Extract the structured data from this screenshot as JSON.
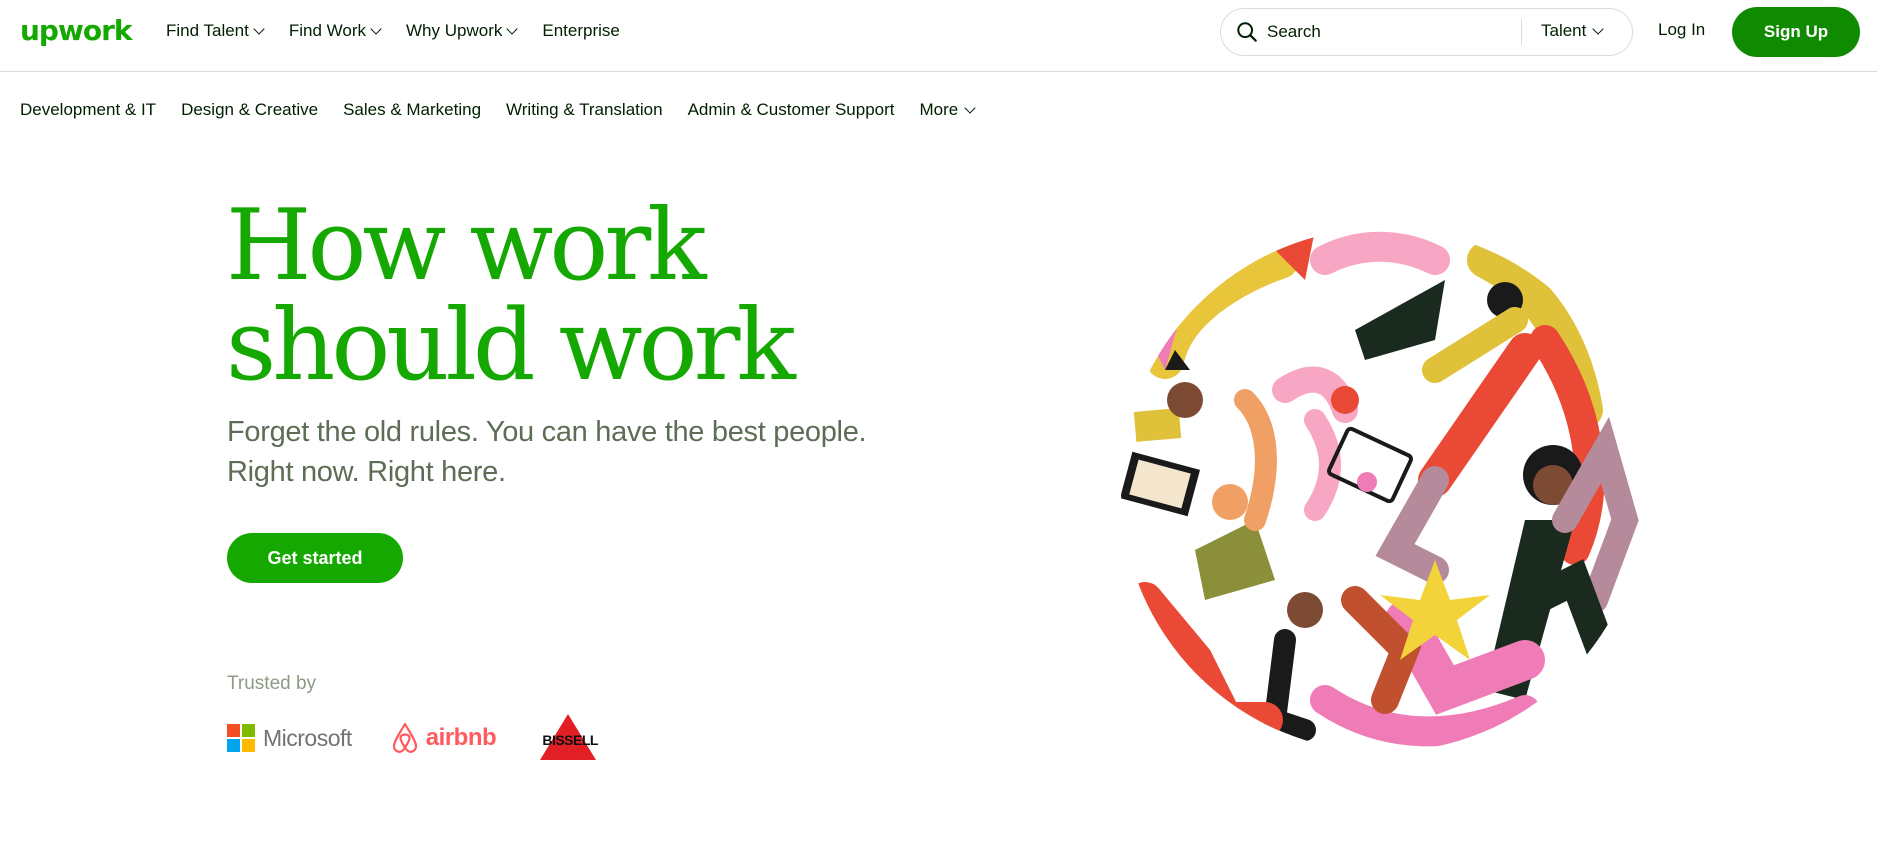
{
  "brand": {
    "logo_text": "upwork",
    "color": "#14a800"
  },
  "nav": {
    "items": [
      {
        "label": "Find Talent",
        "dropdown": true
      },
      {
        "label": "Find Work",
        "dropdown": true
      },
      {
        "label": "Why Upwork",
        "dropdown": true
      },
      {
        "label": "Enterprise",
        "dropdown": false
      }
    ]
  },
  "search": {
    "placeholder": "Search",
    "scope": "Talent",
    "icon": "search-icon"
  },
  "auth": {
    "login": "Log In",
    "signup": "Sign Up",
    "signup_color": "#108a00"
  },
  "categories": {
    "items": [
      "Development & IT",
      "Design & Creative",
      "Sales & Marketing",
      "Writing & Translation",
      "Admin & Customer Support"
    ],
    "more": "More"
  },
  "hero": {
    "title_line1": "How work",
    "title_line2": "should work",
    "subtitle_line1": "Forget the old rules. You can have the best people.",
    "subtitle_line2": "Right now. Right here.",
    "cta": "Get started"
  },
  "trusted": {
    "label": "Trusted by",
    "logos": {
      "microsoft": "Microsoft",
      "airbnb": "airbnb",
      "bissell": "BISSELL"
    }
  },
  "colors": {
    "accent": "#14a800",
    "text": "#001e00",
    "subtext": "#5e6d55",
    "muted": "#8e9a86"
  }
}
